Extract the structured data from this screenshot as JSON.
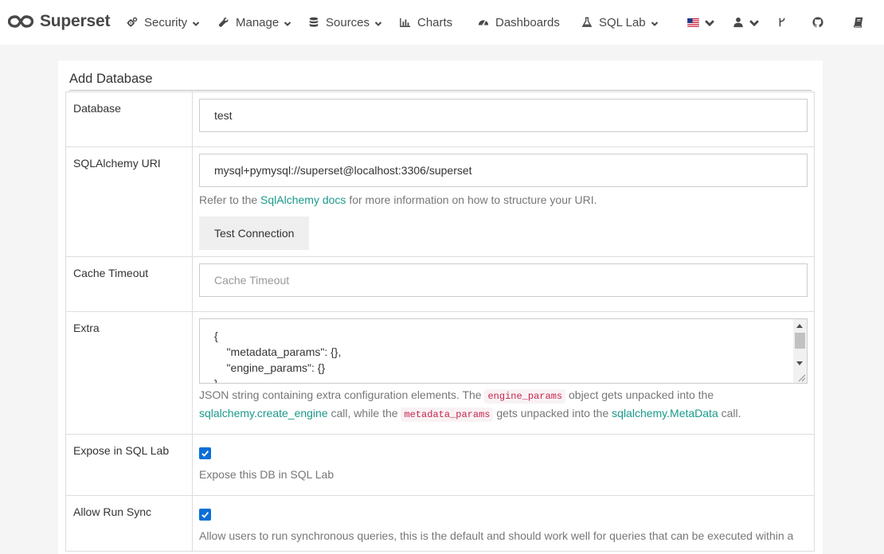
{
  "brand": {
    "name": "Superset"
  },
  "nav": {
    "security": "Security",
    "manage": "Manage",
    "sources": "Sources",
    "charts": "Charts",
    "dashboards": "Dashboards",
    "sqllab": "SQL Lab"
  },
  "icons": {
    "logo": "infinity-logo-icon",
    "security": "gears-icon",
    "manage": "wrench-icon",
    "sources": "database-icon",
    "charts": "bar-chart-icon",
    "dashboards": "dashboard-gauge-icon",
    "sqllab": "flask-icon",
    "language": "us-flag-icon",
    "user": "user-icon",
    "version": "code-fork-icon",
    "github": "github-icon",
    "docs": "book-icon"
  },
  "page": {
    "title": "Add Database"
  },
  "form": {
    "database": {
      "label": "Database",
      "value": "test"
    },
    "sqlalchemy_uri": {
      "label": "SQLAlchemy URI",
      "value": "mysql+pymysql://superset@localhost:3306/superset",
      "help_prefix": "Refer to the ",
      "help_link": "SqlAlchemy docs",
      "help_suffix": " for more information on how to structure your URI."
    },
    "test_connection": "Test Connection",
    "cache_timeout": {
      "label": "Cache Timeout",
      "placeholder": "Cache Timeout"
    },
    "extra": {
      "label": "Extra",
      "line1": "{",
      "line2": "    \"metadata_params\": {},",
      "line3": "    \"engine_params\": {}",
      "line4": "}",
      "help_1": "JSON string containing extra configuration elements. The ",
      "help_code_1": "engine_params",
      "help_2": " object gets unpacked into the ",
      "help_link_1": "sqlalchemy.create_engine",
      "help_3": " call, while the ",
      "help_code_2": "metadata_params",
      "help_4": " gets unpacked into the ",
      "help_link_2": "sqlalchemy.MetaData",
      "help_5": " call."
    },
    "expose_in_sqllab": {
      "label": "Expose in SQL Lab",
      "checked": true,
      "help": "Expose this DB in SQL Lab"
    },
    "allow_run_sync": {
      "label": "Allow Run Sync",
      "checked": true,
      "help": "Allow users to run synchronous queries, this is the default and should work well for queries that can be executed within a"
    }
  },
  "colors": {
    "accent": "#1a998a",
    "checkbox": "#0b6fd6",
    "code": "#c7254e"
  }
}
